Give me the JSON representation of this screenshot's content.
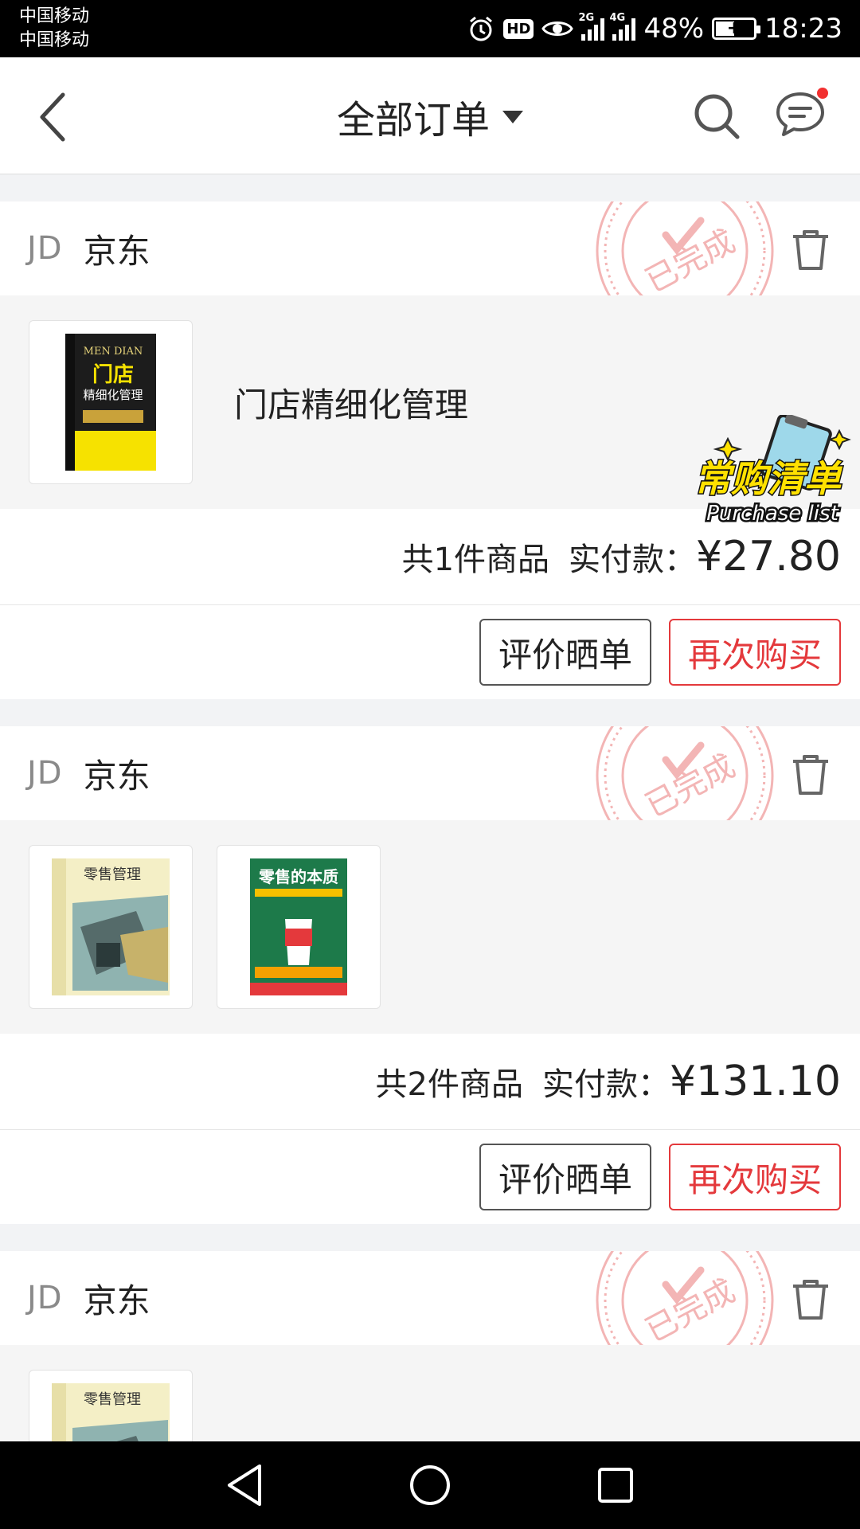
{
  "status_bar": {
    "carrier_1": "中国移动",
    "carrier_2": "中国移动",
    "hd": "HD",
    "net_1": "2G",
    "net_2": "4G",
    "battery": "48%",
    "time": "18:23"
  },
  "header": {
    "title": "全部订单"
  },
  "orders": [
    {
      "shop_logo": "JD",
      "shop_name": "京东",
      "stamp_text": "已完成",
      "product_name": "门店精细化管理",
      "book_1_title": "门店",
      "book_1_subtitle": "精细化管理",
      "book_1_top": "MEN DIAN",
      "sticker_cn": "常购清单",
      "sticker_en": "Purchase list",
      "count": "共1件商品",
      "paid_label": "实付款：",
      "price": "¥27.80",
      "review_label": "评价晒单",
      "rebuy_label": "再次购买"
    },
    {
      "shop_logo": "JD",
      "shop_name": "京东",
      "stamp_text": "已完成",
      "book_1_title": "零售管理",
      "book_2_title": "零售的本质",
      "count": "共2件商品",
      "paid_label": "实付款：",
      "price": "¥131.10",
      "review_label": "评价晒单",
      "rebuy_label": "再次购买"
    },
    {
      "shop_logo": "JD",
      "shop_name": "京东",
      "stamp_text": "已完成",
      "book_1_title": "零售管理"
    }
  ],
  "colors": {
    "accent_red": "#e4393c",
    "stamp_red": "#f0a0a0"
  },
  "icons": [
    "back-arrow-icon",
    "dropdown-caret-icon",
    "search-icon",
    "message-icon",
    "trash-icon",
    "nav-back-icon",
    "nav-home-icon",
    "nav-recents-icon"
  ]
}
